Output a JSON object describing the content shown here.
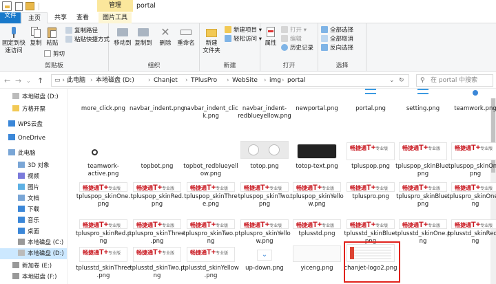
{
  "window": {
    "title": "portal",
    "manage_tab": "管理"
  },
  "tabs": [
    "文件",
    "主页",
    "共享",
    "查看",
    "图片工具"
  ],
  "ribbon": {
    "clipboard": {
      "label": "剪贴板",
      "pin": "固定到快\n速访问",
      "copy": "复制",
      "paste": "粘贴",
      "cut": "剪切",
      "copy_path": "复制路径",
      "paste_shortcut": "粘贴快捷方式"
    },
    "organize": {
      "label": "组织",
      "move_to": "移动到",
      "copy_to": "复制到",
      "delete": "删除",
      "rename": "重命名"
    },
    "new": {
      "label": "新建",
      "new_folder": "新建\n文件夹",
      "new_item": "新建项目 ▾",
      "easy_access": "轻松访问 ▾"
    },
    "open": {
      "label": "打开",
      "properties": "属性",
      "open": "打开 ▾",
      "edit": "编辑",
      "history": "历史记录"
    },
    "select": {
      "label": "选择",
      "select_all": "全部选择",
      "select_none": "全部取消",
      "invert": "反向选择"
    }
  },
  "address": {
    "crumbs": [
      "此电脑",
      "本地磁盘 (D:)",
      "Chanjet",
      "TPlusPro",
      "WebSite",
      "img",
      "portal"
    ],
    "search_placeholder": "在 portal 中搜索"
  },
  "nav": [
    "本地磁盘 (D:)",
    "方格开票",
    "WPS云盘",
    "OneDrive",
    "此电脑",
    "3D 对象",
    "视频",
    "图片",
    "文档",
    "下载",
    "音乐",
    "桌面",
    "本地磁盘 (C:)",
    "本地磁盘 (D:)",
    "新加卷 (E:)",
    "本地磁盘 (F:)"
  ],
  "files": [
    "more_click.png",
    "navbar_indent.png",
    "navbar_indent_click.png",
    "navbar_indent-redblueyellow.png",
    "newportal.png",
    "portal.png",
    "setting.png",
    "teamwork.png",
    "teamwork-active.png",
    "topbot.png",
    "topbot_redblueyellow.png",
    "totop.png",
    "totop-text.png",
    "tpluspop.png",
    "tpluspop_skinBlue.png",
    "tpluspop_skinOne.png",
    "tpluspop_skinOne.png",
    "tpluspop_skinRed.png",
    "tpluspop_skinThree.png",
    "tpluspop_skinTwo.png",
    "tpluspop_skinYellow.png",
    "tpluspro.png",
    "tpluspro_skinBlue.png",
    "tpluspro_skinOne.png",
    "tpluspro_skinRed.png",
    "tpluspro_skinThree.png",
    "tpluspro_skinTwo.png",
    "tpluspro_skinYellow.png",
    "tplusstd.png",
    "tplusstd_skinBlue.png",
    "tplusstd_skinOne.png",
    "tplusstd_skinRed.png",
    "tplusstd_skinThree.png",
    "tplusstd_skinTwo.png",
    "tplusstd_skinYellow.png",
    "up-down.png",
    "yiceng.png",
    "chanjet-logo2.png"
  ],
  "logo_text": {
    "brand": "畅捷通",
    "t": "T+",
    "edition": "专业版"
  },
  "colors": {
    "accent": "#1979ca",
    "selection": "#cce8ff",
    "highlight": "#e1221c",
    "logo_red": "#c8151d"
  }
}
